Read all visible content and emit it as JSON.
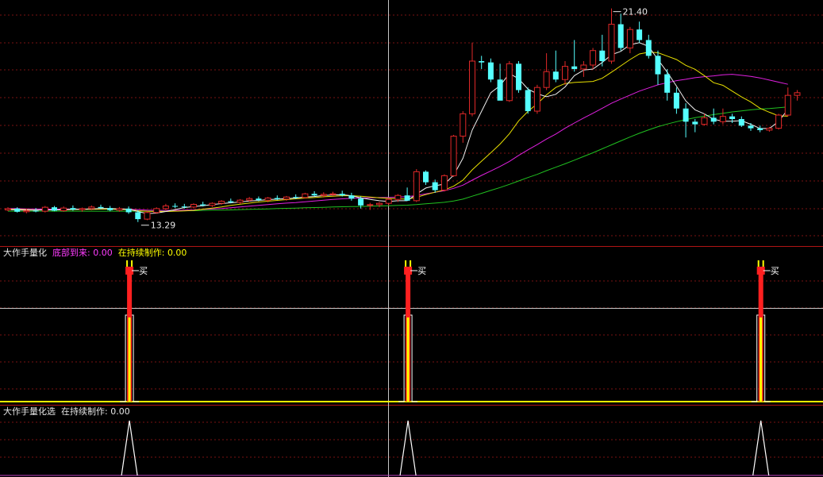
{
  "panels": {
    "main": {
      "annotations": {
        "high_label": "21.40",
        "low_label": "13.29"
      }
    },
    "indicator1": {
      "name": "大作手量化",
      "series1_label": "底部到来:",
      "series1_value": "0.00",
      "series2_label": "在持续制作:",
      "series2_value": "0.00",
      "signal_text": "买"
    },
    "indicator2": {
      "name": "大作手量化选",
      "series_label": "在持续制作:",
      "series_value": "0.00"
    }
  },
  "colors": {
    "background": "#000000",
    "grid": "#7a1212",
    "separator": "#b01414",
    "up_candle": "#e02828",
    "down_candle": "#55ffff",
    "ma5": "#f0f0f0",
    "ma10": "#e8e000",
    "ma20": "#e020e0",
    "ma60": "#20c020",
    "cursor": "#c8c8c8",
    "signal_red": "#ff2020",
    "signal_yellow": "#ffff00",
    "spike_white": "#ffffff"
  },
  "chart_data": [
    {
      "type": "candlestick",
      "title": "",
      "price_range": [
        12.8,
        21.6
      ],
      "candles": [
        [
          13.75,
          13.85,
          13.7,
          13.8
        ],
        [
          13.8,
          13.85,
          13.65,
          13.68
        ],
        [
          13.68,
          13.8,
          13.62,
          13.72
        ],
        [
          13.72,
          13.82,
          13.66,
          13.7
        ],
        [
          13.7,
          13.9,
          13.65,
          13.85
        ],
        [
          13.85,
          13.9,
          13.7,
          13.72
        ],
        [
          13.72,
          13.88,
          13.68,
          13.82
        ],
        [
          13.82,
          13.92,
          13.72,
          13.76
        ],
        [
          13.76,
          13.84,
          13.68,
          13.8
        ],
        [
          13.8,
          13.92,
          13.74,
          13.86
        ],
        [
          13.86,
          13.95,
          13.78,
          13.82
        ],
        [
          13.82,
          13.9,
          13.7,
          13.74
        ],
        [
          13.74,
          13.86,
          13.68,
          13.8
        ],
        [
          13.8,
          13.88,
          13.6,
          13.66
        ],
        [
          13.66,
          13.74,
          13.29,
          13.4
        ],
        [
          13.4,
          13.7,
          13.36,
          13.65
        ],
        [
          13.65,
          13.85,
          13.6,
          13.8
        ],
        [
          13.8,
          13.98,
          13.72,
          13.9
        ],
        [
          13.9,
          14.0,
          13.82,
          13.88
        ],
        [
          13.88,
          13.98,
          13.8,
          13.86
        ],
        [
          13.86,
          14.0,
          13.8,
          13.96
        ],
        [
          13.96,
          14.06,
          13.88,
          13.92
        ],
        [
          13.92,
          14.04,
          13.86,
          14.0
        ],
        [
          14.0,
          14.12,
          13.94,
          14.08
        ],
        [
          14.08,
          14.18,
          14.0,
          14.04
        ],
        [
          14.04,
          14.16,
          13.98,
          14.12
        ],
        [
          14.12,
          14.24,
          14.06,
          14.18
        ],
        [
          14.18,
          14.26,
          14.08,
          14.12
        ],
        [
          14.12,
          14.24,
          14.04,
          14.2
        ],
        [
          14.2,
          14.3,
          14.12,
          14.16
        ],
        [
          14.16,
          14.28,
          14.1,
          14.24
        ],
        [
          14.24,
          14.34,
          14.16,
          14.22
        ],
        [
          14.22,
          14.4,
          14.18,
          14.36
        ],
        [
          14.36,
          14.46,
          14.26,
          14.3
        ],
        [
          14.3,
          14.42,
          14.22,
          14.34
        ],
        [
          14.34,
          14.44,
          14.28,
          14.36
        ],
        [
          14.36,
          14.48,
          14.26,
          14.3
        ],
        [
          14.3,
          14.4,
          14.1,
          14.18
        ],
        [
          14.18,
          14.26,
          13.8,
          13.92
        ],
        [
          13.92,
          14.02,
          13.75,
          13.95
        ],
        [
          13.95,
          14.05,
          13.85,
          14.0
        ],
        [
          14.0,
          14.2,
          13.92,
          14.15
        ],
        [
          14.15,
          14.35,
          14.05,
          14.3
        ],
        [
          14.3,
          14.6,
          14.2,
          14.1
        ],
        [
          14.1,
          15.3,
          14.05,
          15.2
        ],
        [
          15.2,
          15.25,
          14.7,
          14.8
        ],
        [
          14.8,
          14.9,
          14.4,
          14.5
        ],
        [
          14.5,
          15.1,
          14.45,
          15.05
        ],
        [
          15.05,
          16.6,
          15.0,
          16.55
        ],
        [
          16.55,
          17.5,
          16.3,
          17.4
        ],
        [
          17.4,
          20.1,
          17.3,
          19.4
        ],
        [
          19.4,
          19.6,
          19.1,
          19.35
        ],
        [
          19.35,
          19.5,
          18.6,
          18.7
        ],
        [
          18.7,
          19.3,
          18.1,
          17.9
        ],
        [
          17.9,
          19.4,
          17.85,
          19.3
        ],
        [
          19.3,
          19.4,
          18.2,
          18.3
        ],
        [
          18.3,
          18.4,
          17.4,
          17.5
        ],
        [
          17.5,
          18.5,
          17.4,
          18.4
        ],
        [
          18.4,
          19.7,
          18.3,
          19.0
        ],
        [
          19.0,
          19.8,
          18.6,
          18.7
        ],
        [
          18.7,
          19.4,
          18.5,
          19.2
        ],
        [
          19.2,
          20.2,
          19.0,
          19.1
        ],
        [
          19.1,
          19.4,
          18.8,
          19.25
        ],
        [
          19.25,
          19.9,
          19.1,
          19.8
        ],
        [
          19.8,
          20.4,
          19.2,
          19.4
        ],
        [
          19.4,
          21.4,
          19.3,
          20.8
        ],
        [
          20.8,
          21.2,
          19.8,
          19.9
        ],
        [
          19.9,
          20.7,
          19.7,
          20.6
        ],
        [
          20.6,
          20.9,
          20.1,
          20.2
        ],
        [
          20.2,
          20.4,
          19.5,
          19.6
        ],
        [
          19.6,
          19.8,
          18.5,
          18.9
        ],
        [
          18.9,
          19.1,
          17.9,
          18.2
        ],
        [
          18.2,
          18.4,
          17.4,
          17.6
        ],
        [
          17.6,
          17.8,
          16.5,
          17.1
        ],
        [
          17.1,
          17.2,
          16.7,
          17.0
        ],
        [
          17.0,
          17.4,
          16.95,
          17.25
        ],
        [
          17.25,
          17.6,
          17.0,
          17.1
        ],
        [
          17.1,
          17.6,
          17.0,
          17.3
        ],
        [
          17.3,
          17.4,
          17.05,
          17.2
        ],
        [
          17.2,
          17.3,
          16.9,
          16.95
        ],
        [
          16.95,
          17.05,
          16.75,
          16.85
        ],
        [
          16.85,
          16.95,
          16.7,
          16.78
        ],
        [
          16.78,
          16.9,
          16.72,
          16.85
        ],
        [
          16.85,
          17.4,
          16.8,
          17.35
        ],
        [
          17.35,
          18.4,
          17.3,
          18.1
        ],
        [
          18.1,
          18.3,
          17.9,
          18.2
        ]
      ],
      "ma5": [
        13.76,
        13.75,
        13.74,
        13.74,
        13.75,
        13.75,
        13.76,
        13.77,
        13.78,
        13.79,
        13.8,
        13.8,
        13.79,
        13.78,
        13.69,
        13.61,
        13.63,
        13.69,
        13.76,
        13.84,
        13.88,
        13.91,
        13.95,
        13.99,
        14.02,
        14.05,
        14.09,
        14.11,
        14.14,
        14.16,
        14.18,
        14.2,
        14.24,
        14.26,
        14.3,
        14.32,
        14.33,
        14.29,
        14.21,
        14.15,
        14.1,
        14.07,
        14.1,
        14.1,
        14.35,
        14.58,
        14.67,
        14.73,
        15.07,
        15.71,
        16.78,
        17.49,
        18.2,
        18.47,
        18.93,
        18.73,
        18.34,
        18.16,
        18.05,
        18.14,
        18.42,
        18.85,
        19.06,
        19.1,
        19.35,
        19.64,
        19.77,
        20.02,
        20.1,
        19.96,
        19.46,
        18.98,
        18.45,
        17.89,
        17.55,
        17.4,
        17.19,
        17.12,
        17.12,
        17.14,
        17.0,
        16.84,
        16.84,
        17.11,
        17.57
      ],
      "ma10": [
        13.78,
        13.77,
        13.76,
        13.75,
        13.75,
        13.75,
        13.75,
        13.76,
        13.77,
        13.77,
        13.78,
        13.78,
        13.77,
        13.76,
        13.72,
        13.7,
        13.69,
        13.69,
        13.7,
        13.71,
        13.73,
        13.78,
        13.82,
        13.86,
        13.92,
        13.97,
        14.01,
        14.05,
        14.08,
        14.11,
        14.14,
        14.17,
        14.2,
        14.22,
        14.25,
        14.27,
        14.29,
        14.29,
        14.27,
        14.24,
        14.21,
        14.19,
        14.17,
        14.16,
        14.23,
        14.33,
        14.42,
        14.51,
        14.65,
        14.88,
        15.27,
        15.6,
        15.92,
        16.25,
        16.64,
        17.13,
        17.49,
        17.78,
        18.12,
        18.4,
        18.55,
        18.59,
        18.61,
        18.63,
        18.75,
        18.98,
        19.22,
        19.46,
        19.67,
        19.74,
        19.72,
        19.59,
        19.46,
        19.24,
        19.09,
        18.85,
        18.58,
        18.48,
        18.26,
        18.04,
        17.85,
        17.61,
        17.46,
        17.32,
        17.31
      ],
      "ma20": [
        13.8,
        13.8,
        13.79,
        13.79,
        13.78,
        13.78,
        13.78,
        13.78,
        13.78,
        13.78,
        13.78,
        13.78,
        13.77,
        13.77,
        13.76,
        13.74,
        13.73,
        13.73,
        13.73,
        13.74,
        13.75,
        13.77,
        13.79,
        13.8,
        13.83,
        13.86,
        13.89,
        13.92,
        13.95,
        13.98,
        14.01,
        14.03,
        14.06,
        14.09,
        14.12,
        14.15,
        14.17,
        14.19,
        14.2,
        14.21,
        14.22,
        14.22,
        14.24,
        14.25,
        14.3,
        14.36,
        14.42,
        14.48,
        14.57,
        14.69,
        14.88,
        15.06,
        15.23,
        15.4,
        15.59,
        15.82,
        16.03,
        16.23,
        16.44,
        16.63,
        16.85,
        17.05,
        17.24,
        17.42,
        17.61,
        17.8,
        17.96,
        18.11,
        18.26,
        18.38,
        18.5,
        18.58,
        18.66,
        18.71,
        18.77,
        18.81,
        18.84,
        18.88,
        18.9,
        18.86,
        18.82,
        18.76,
        18.68,
        18.6,
        18.52
      ],
      "ma60": [
        13.7,
        13.7,
        13.7,
        13.7,
        13.7,
        13.7,
        13.7,
        13.7,
        13.7,
        13.7,
        13.7,
        13.7,
        13.7,
        13.7,
        13.7,
        13.7,
        13.7,
        13.71,
        13.71,
        13.72,
        13.72,
        13.73,
        13.74,
        13.74,
        13.75,
        13.76,
        13.77,
        13.78,
        13.79,
        13.8,
        13.81,
        13.82,
        13.83,
        13.84,
        13.85,
        13.86,
        13.87,
        13.88,
        13.88,
        13.89,
        13.9,
        13.91,
        13.92,
        13.93,
        13.95,
        13.98,
        14.01,
        14.04,
        14.09,
        14.16,
        14.27,
        14.38,
        14.49,
        14.6,
        14.72,
        14.85,
        14.98,
        15.1,
        15.24,
        15.37,
        15.5,
        15.64,
        15.78,
        15.92,
        16.07,
        16.22,
        16.37,
        16.52,
        16.66,
        16.79,
        16.91,
        17.01,
        17.1,
        17.18,
        17.25,
        17.31,
        17.37,
        17.42,
        17.47,
        17.51,
        17.55,
        17.58,
        17.6,
        17.63,
        17.66
      ]
    },
    {
      "type": "line",
      "title": "大作手量化",
      "signal_indices": [
        13,
        43,
        81
      ],
      "signal_label": "买",
      "values_shown": {
        "底部到来": 0.0,
        "在持续制作": 0.0
      }
    },
    {
      "type": "line",
      "title": "大作手量化选",
      "signal_indices": [
        13,
        43,
        81
      ],
      "values_shown": {
        "在持续制作": 0.0
      }
    }
  ]
}
